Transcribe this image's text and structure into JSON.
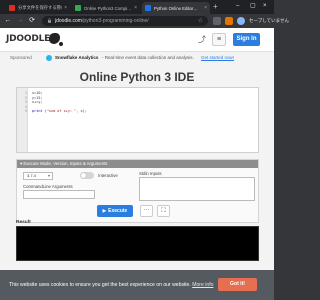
{
  "browser": {
    "tabs": [
      {
        "title": "分享文件を保存する際の…"
      },
      {
        "title": "Online Python3 Compi…"
      },
      {
        "title": "Python Online Editor…"
      }
    ],
    "new_tab": "+",
    "url_domain": "jdoodle.com",
    "url_path": "/python3-programming-online/",
    "profile": "セーブしていません"
  },
  "site": {
    "logo": "JDOODLE",
    "sign_in": "Sign In",
    "sponsor_label": "Sponsored",
    "sponsor_brand": "Snowflake Analytics",
    "sponsor_text": "- Real-time event data collection and analysis.",
    "sponsor_cta": "Get started now!"
  },
  "page": {
    "title": "Online Python 3 IDE"
  },
  "editor": {
    "line_numbers": [
      "1",
      "2",
      "3",
      "4",
      "5"
    ],
    "lines": [
      {
        "a": "x=10;"
      },
      {
        "a": "y=15;"
      },
      {
        "a": "x+=y;"
      },
      {
        "a": ""
      },
      {
        "a": "print (",
        "s": "\"sum of x+y: \"",
        "b": ", x);"
      }
    ]
  },
  "exec_panel": {
    "header": "Execute Mode, Version, Inputs & Arguments",
    "version": "3.7.4",
    "interactive_label": "Interactive",
    "interactive_on": false,
    "cmd_args_label": "CommandLine Arguments",
    "stdin_label": "Stdin Inputs"
  },
  "actions": {
    "execute": "Execute"
  },
  "result": {
    "label": "Result",
    "output": ""
  },
  "cookie": {
    "message": "This website uses cookies to ensure you get the best experience on our website.",
    "more": "More info",
    "got_it": "Got it!"
  }
}
